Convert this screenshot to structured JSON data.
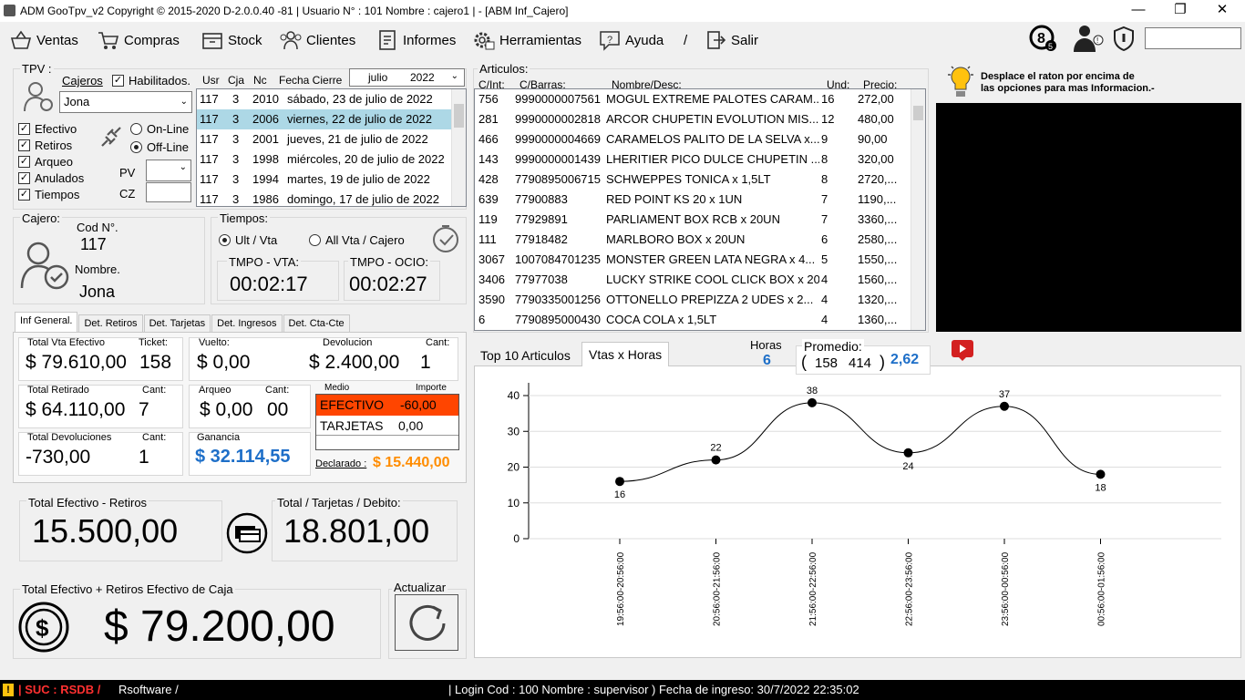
{
  "window": {
    "title": "ADM GooTpv_v2 Copyright ©  2015-2020 D-2.0.0.40 -81 | Usuario N° : 101 Nombre : cajero1 | - [ABM Inf_Cajero]",
    "min": "—",
    "max": "❐",
    "close": "✕"
  },
  "menu": [
    "Ventas",
    "Compras",
    "Stock",
    "Clientes",
    "Informes",
    "Herramientas",
    "Ayuda",
    "/",
    "Salir"
  ],
  "tpv": {
    "label": "TPV :",
    "cajeros": "Cajeros",
    "habilitados": "Habilitados.",
    "cajero": "Jona",
    "checks": [
      "Efectivo",
      "Retiros",
      "Arqueo",
      "Anulados",
      "Tiempos"
    ],
    "online": "On-Line",
    "offline": "Off-Line",
    "pv": "PV",
    "cz": "CZ",
    "month": "julio",
    "year": "2022",
    "cols": [
      "Usr",
      "Cja",
      "Nc",
      "Fecha Cierre"
    ],
    "rows": [
      [
        "117",
        "3",
        "2010",
        "sábado, 23 de julio de 2022"
      ],
      [
        "117",
        "3",
        "2006",
        "viernes, 22 de julio de 2022"
      ],
      [
        "117",
        "3",
        "2001",
        "jueves, 21 de julio de 2022"
      ],
      [
        "117",
        "3",
        "1998",
        "miércoles, 20 de julio de 2022"
      ],
      [
        "117",
        "3",
        "1994",
        "martes, 19 de julio de 2022"
      ],
      [
        "117",
        "3",
        "1986",
        "domingo, 17 de julio de 2022"
      ]
    ]
  },
  "cajero": {
    "label": "Cajero:",
    "cod_label": "Cod N°.",
    "cod": "117",
    "nombre_label": "Nombre.",
    "nombre": "Jona"
  },
  "tiempos": {
    "label": "Tiempos:",
    "opt1": "Ult / Vta",
    "opt2": "All Vta / Cajero",
    "vta_label": "TMPO - VTA:",
    "vta": "00:02:17",
    "ocio_label": "TMPO - OCIO:",
    "ocio": "00:02:27"
  },
  "tabs": [
    "Inf General.",
    "Det. Retiros",
    "Det. Tarjetas",
    "Det. Ingresos",
    "Det. Cta-Cte"
  ],
  "inf": {
    "tve_l": "Total Vta Efectivo",
    "tve": "$ 79.610,00",
    "ticket_l": "Ticket:",
    "ticket": "158",
    "vuelto_l": "Vuelto:",
    "vuelto": "$ 0,00",
    "dev_l": "Devolucion",
    "dev": "$ 2.400,00",
    "cant_l": "Cant:",
    "dev_cant": "1",
    "tr_l": "Total Retirado",
    "tr": "$ 64.110,00",
    "tr_cant": "7",
    "arq_l": "Arqueo",
    "arq": "$ 0,00",
    "arq_cant": "00",
    "medio_l": "Medio",
    "importe_l": "Importe",
    "medios": [
      [
        "EFECTIVO",
        "-60,00"
      ],
      [
        "TARJETAS",
        "0,00"
      ]
    ],
    "td_l": "Total Devoluciones",
    "td": "-730,00",
    "td_cant": "1",
    "gan_l": "Ganancia",
    "gan": "$ 32.114,55",
    "decl_l": "Declarado :",
    "decl": "$ 15.440,00"
  },
  "totals": {
    "ef_l": "Total  Efectivo - Retiros",
    "ef": "15.500,00",
    "tar_l": "Total / Tarjetas / Debito:",
    "tar": "18.801,00",
    "caja_l": "Total Efectivo + Retiros Efectivo de Caja",
    "caja": "$ 79.200,00",
    "act_l": "Actualizar"
  },
  "articulos": {
    "label": "Articulos:",
    "cols": [
      "C/Int:",
      "C/Barras:",
      "Nombre/Desc:",
      "Und:",
      "Precio:"
    ],
    "rows": [
      [
        "756",
        "9990000007561",
        "MOGUL EXTREME PALOTES CARAM...",
        "16",
        "272,00"
      ],
      [
        "281",
        "9990000002818",
        "ARCOR CHUPETIN EVOLUTION MIS...",
        "12",
        "480,00"
      ],
      [
        "466",
        "9990000004669",
        "CARAMELOS PALITO DE LA SELVA  x...",
        "9",
        "90,00"
      ],
      [
        "143",
        "9990000001439",
        "LHERITIER PICO DULCE CHUPETIN ...",
        "8",
        "320,00"
      ],
      [
        "428",
        "7790895006715",
        "SCHWEPPES TONICA  x 1,5LT",
        "8",
        "2720,..."
      ],
      [
        "639",
        "77900883",
        "RED POINT KS 20  x 1UN",
        "7",
        "1190,..."
      ],
      [
        "119",
        "77929891",
        "PARLIAMENT BOX  RCB  x 20UN",
        "7",
        "3360,..."
      ],
      [
        "111",
        "77918482",
        "MARLBORO BOX  x 20UN",
        "6",
        "2580,..."
      ],
      [
        "3067",
        "1007084701235",
        "MONSTER GREEN LATA NEGRA  x 4...",
        "5",
        "1550,..."
      ],
      [
        "3406",
        "77977038",
        "LUCKY STRIKE COOL CLICK BOX  x 20...",
        "4",
        "1560,..."
      ],
      [
        "3590",
        "7790335001256",
        "OTTONELLO  PREPIZZA 2 UDES   x 2...",
        "4",
        "1320,..."
      ],
      [
        "6",
        "7790895000430",
        "COCA COLA  x 1,5LT",
        "4",
        "1360,..."
      ]
    ]
  },
  "info": {
    "text1": "Desplace el raton por encima de",
    "text2": "las opciones para mas Informacion.-"
  },
  "chart_tabs": [
    "Top 10 Articulos",
    "Vtas x Horas"
  ],
  "horas": {
    "label": "Horas",
    "value": "6"
  },
  "promedio": {
    "label": "Promedio:",
    "a": "158",
    "b": "414",
    "value": "2,62"
  },
  "chart_data": {
    "type": "line",
    "x": [
      "19:56:00-20:56:00",
      "20:56:00-21:56:00",
      "21:56:00-22:56:00",
      "22:56:00-23:56:00",
      "23:56:00-00:56:00",
      "00:56:00-01:56:00"
    ],
    "values": [
      16,
      22,
      38,
      24,
      37,
      18
    ],
    "yticks": [
      0,
      10,
      20,
      30,
      40
    ],
    "ylim": [
      0,
      40
    ],
    "grid": true
  },
  "status": {
    "warn": "!",
    "suc": "| SUC : RSDB /",
    "rs": "Rsoftware /",
    "login": "| Login Cod : 100 Nombre : supervisor ) Fecha de ingreso: 30/7/2022 22:35:02"
  },
  "colors": {
    "selected": "#add8e6",
    "efectivo": "#ff4500",
    "blue": "#1e6fc8",
    "orange": "#ff8c00",
    "youtube": "#d32020"
  }
}
